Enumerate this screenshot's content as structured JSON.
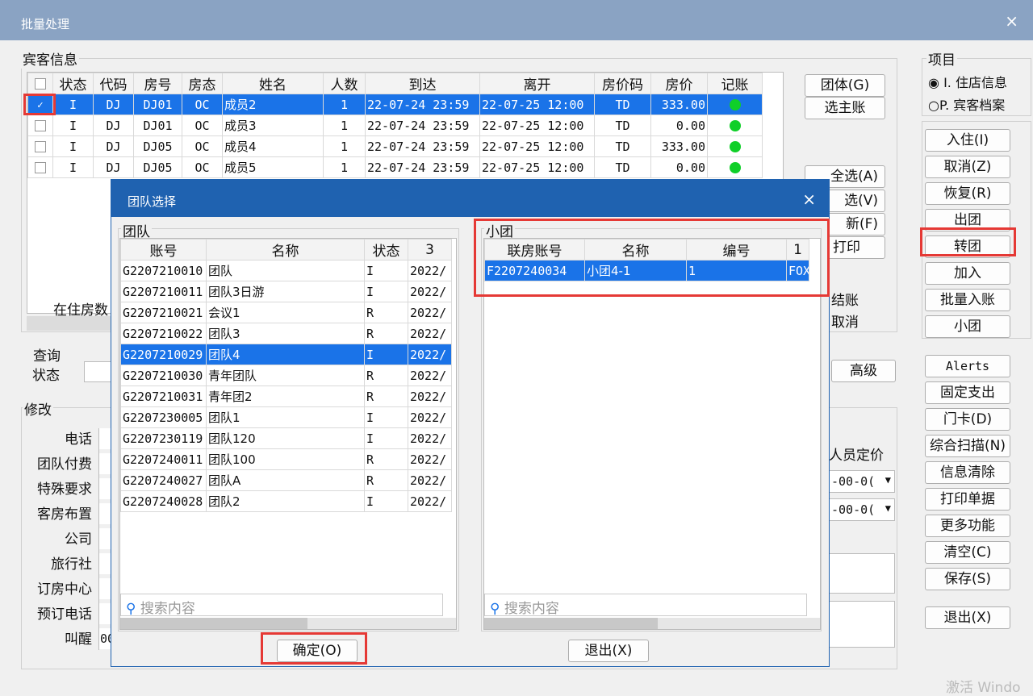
{
  "window": {
    "title": "批量处理",
    "close": "×"
  },
  "guest": {
    "title": "宾客信息",
    "columns": [
      "状态",
      "代码",
      "房号",
      "房态",
      "姓名",
      "人数",
      "到达",
      "离开",
      "房价码",
      "房价",
      "记账"
    ],
    "rows": [
      {
        "status": "I",
        "code": "DJ",
        "room": "DJ01",
        "rstate": "OC",
        "name": "成员2",
        "count": "1",
        "arrive": "22-07-24 23:59",
        "leave": "22-07-25 12:00",
        "ratecode": "TD",
        "price": "333.00",
        "checked": true
      },
      {
        "status": "I",
        "code": "DJ",
        "room": "DJ01",
        "rstate": "OC",
        "name": "成员3",
        "count": "1",
        "arrive": "22-07-24 23:59",
        "leave": "22-07-25 12:00",
        "ratecode": "TD",
        "price": "0.00",
        "checked": false
      },
      {
        "status": "I",
        "code": "DJ",
        "room": "DJ05",
        "rstate": "OC",
        "name": "成员4",
        "count": "1",
        "arrive": "22-07-24 23:59",
        "leave": "22-07-25 12:00",
        "ratecode": "TD",
        "price": "333.00",
        "checked": false
      },
      {
        "status": "I",
        "code": "DJ",
        "room": "DJ05",
        "rstate": "OC",
        "name": "成员5",
        "count": "1",
        "arrive": "22-07-24 23:59",
        "leave": "22-07-25 12:00",
        "ratecode": "TD",
        "price": "0.00",
        "checked": false
      }
    ],
    "occupancy_label": "在住房数"
  },
  "middle_buttons": {
    "group": "团体(G)",
    "main": "选主账",
    "selall": "全选(A)",
    "invert": "选(V)",
    "refresh": "新(F)",
    "print": "打印",
    "settle": "结账",
    "cancel": "取消",
    "advanced": "高级"
  },
  "query": {
    "title": "查询",
    "status": "状态"
  },
  "modify": {
    "title": "修改",
    "fields": [
      "电话",
      "团队付费",
      "特殊要求",
      "客房布置",
      "公司",
      "旅行社",
      "订房中心",
      "预订电话",
      "叫醒"
    ],
    "wake_value": "00",
    "pricing": "人员定价",
    "date1": "-00-0(",
    "date2": "-00-0("
  },
  "project": {
    "title": "项目",
    "opt1": "I. 住店信息",
    "opt2": "P. 宾客档案"
  },
  "right_buttons": [
    "入住(I)",
    "取消(Z)",
    "恢复(R)",
    "出团",
    "转团",
    "加入",
    "批量入账",
    "小团"
  ],
  "right_buttons2": [
    "Alerts",
    "固定支出",
    "门卡(D)",
    "综合扫描(N)",
    "信息清除",
    "打印单据",
    "更多功能",
    "清空(C)",
    "保存(S)"
  ],
  "exit": "退出(X)",
  "dialog": {
    "title": "团队选择",
    "close": "×",
    "team_title": "团队",
    "team_cols": [
      "账号",
      "名称",
      "状态",
      "3"
    ],
    "teams": [
      {
        "acct": "G2207210010",
        "name": "团队",
        "st": "I",
        "date": "2022/"
      },
      {
        "acct": "G2207210011",
        "name": "团队3日游",
        "st": "I",
        "date": "2022/"
      },
      {
        "acct": "G2207210021",
        "name": "会议1",
        "st": "R",
        "date": "2022/"
      },
      {
        "acct": "G2207210022",
        "name": "团队3",
        "st": "R",
        "date": "2022/"
      },
      {
        "acct": "G2207210029",
        "name": "团队4",
        "st": "I",
        "date": "2022/"
      },
      {
        "acct": "G2207210030",
        "name": "青年团队",
        "st": "R",
        "date": "2022/"
      },
      {
        "acct": "G2207210031",
        "name": "青年团2",
        "st": "R",
        "date": "2022/"
      },
      {
        "acct": "G2207230005",
        "name": "团队1",
        "st": "I",
        "date": "2022/"
      },
      {
        "acct": "G2207230119",
        "name": "团队120",
        "st": "I",
        "date": "2022/"
      },
      {
        "acct": "G2207240011",
        "name": "团队100",
        "st": "R",
        "date": "2022/"
      },
      {
        "acct": "G2207240027",
        "name": "团队A",
        "st": "R",
        "date": "2022/"
      },
      {
        "acct": "G2207240028",
        "name": "团队2",
        "st": "I",
        "date": "2022/"
      }
    ],
    "selected_team": 4,
    "sub_title": "小团",
    "sub_cols": [
      "联房账号",
      "名称",
      "编号",
      "1"
    ],
    "subs": [
      {
        "acct": "F2207240034",
        "name": "小团4-1",
        "num": "1",
        "x": "FOX"
      }
    ],
    "search_placeholder": "搜索内容",
    "ok": "确定(O)",
    "exit": "退出(X)"
  },
  "watermark": "激活 Windo"
}
